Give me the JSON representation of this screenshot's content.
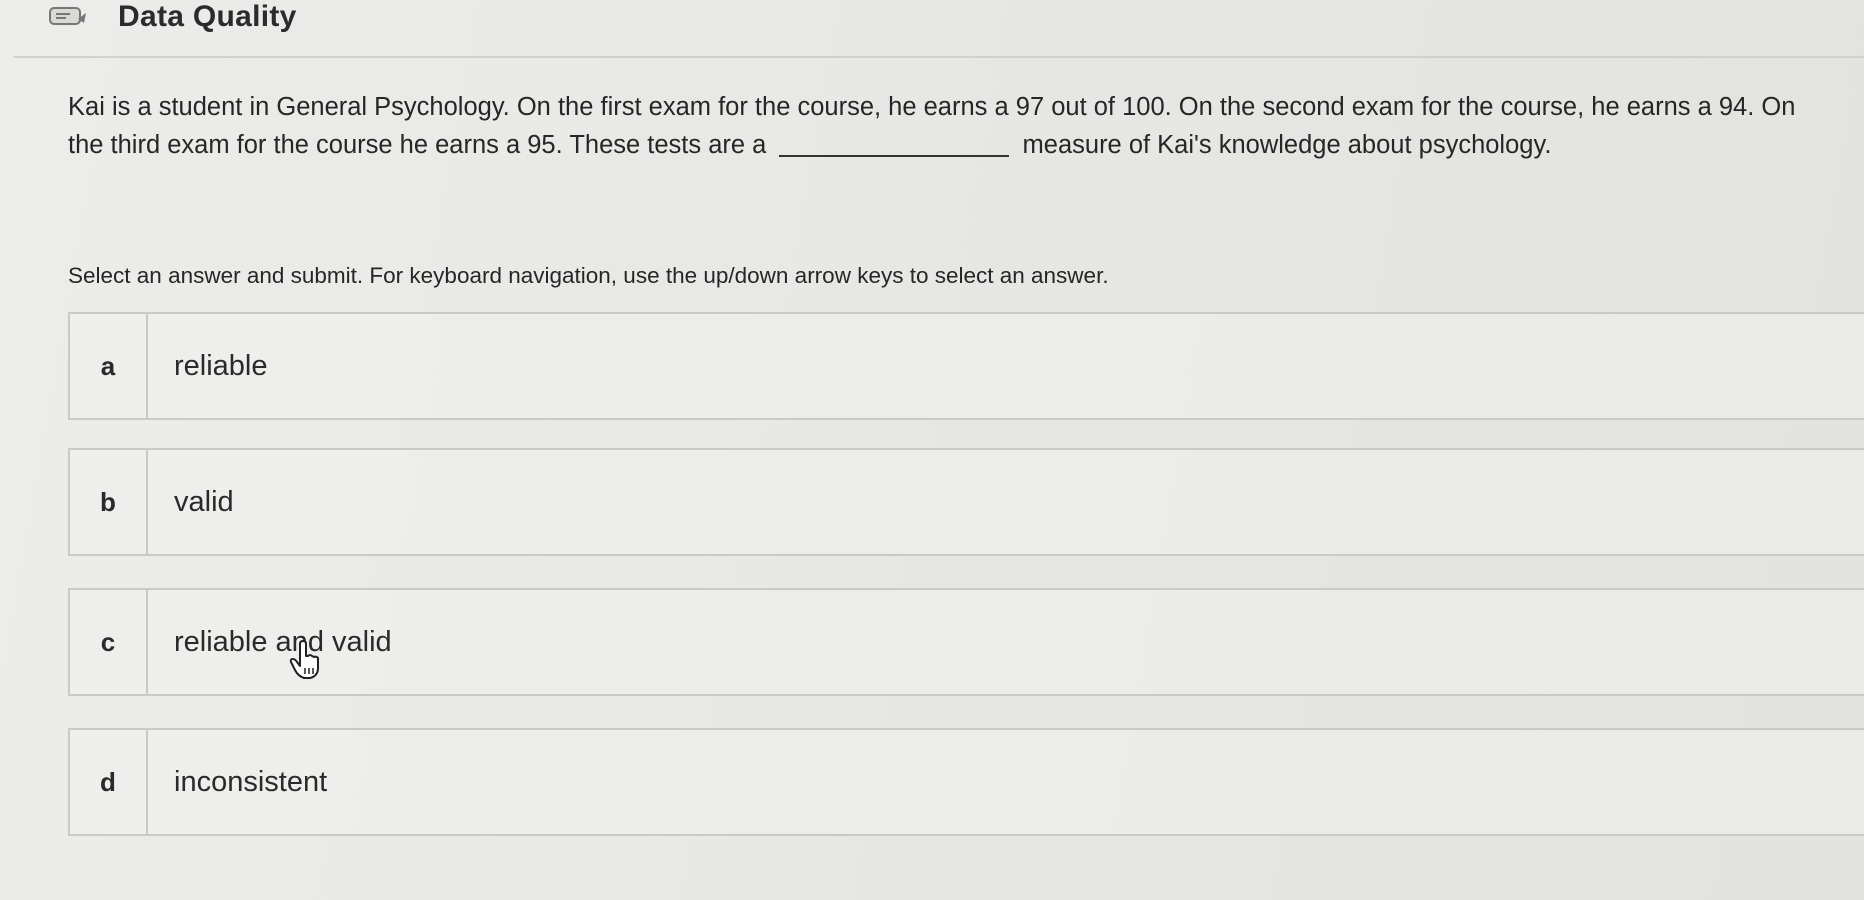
{
  "header": {
    "title": "Data Quality",
    "icon": "quiz-icon"
  },
  "question": {
    "text_before": "Kai is a student in General Psychology.  On the first exam for the course, he earns a 97 out of 100.  On the second exam for the course, he earns a 94.  On the third exam for the course he earns a 95.  These tests are a",
    "text_after": "measure of Kai's knowledge about psychology."
  },
  "instructions": "Select an answer and submit. For keyboard navigation, use the up/down arrow keys to select an answer.",
  "choices": [
    {
      "letter": "a",
      "text": "reliable"
    },
    {
      "letter": "b",
      "text": "valid"
    },
    {
      "letter": "c",
      "text": "reliable and valid"
    },
    {
      "letter": "d",
      "text": "inconsistent"
    }
  ],
  "colors": {
    "background": "#e9e9e7",
    "border": "#c9c9c6",
    "text": "#262626"
  }
}
